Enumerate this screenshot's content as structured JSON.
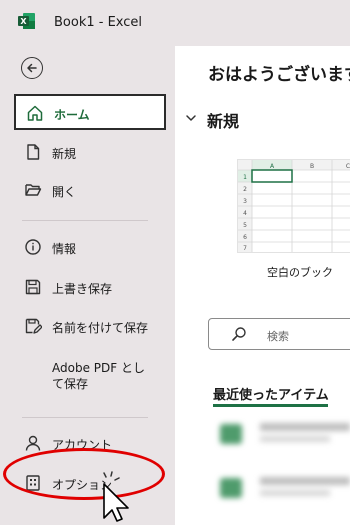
{
  "titlebar": {
    "title": "Book1  -  Excel",
    "logo_icon": "excel-icon",
    "bg_color": "#e9e4e6"
  },
  "sidebar": {
    "back_icon": "back-arrow-icon",
    "items": [
      {
        "label": "ホーム",
        "icon": "home-icon",
        "active": true
      },
      {
        "label": "新規",
        "icon": "new-document-icon"
      },
      {
        "label": "開く",
        "icon": "open-folder-icon"
      },
      {
        "label": "情報",
        "icon": "info-icon"
      },
      {
        "label": "上書き保存",
        "icon": "save-icon"
      },
      {
        "label": "名前を付けて保存",
        "icon": "save-as-icon"
      },
      {
        "label": "Adobe PDF として保存",
        "icon": ""
      },
      {
        "label": "アカウント",
        "icon": "account-icon"
      },
      {
        "label": "オプション",
        "icon": "options-icon"
      }
    ],
    "active_color": "#1e6b3a"
  },
  "main": {
    "greeting": "おはようございます",
    "new_section": {
      "label": "新規"
    },
    "blank_workbook": {
      "label": "空白のブック",
      "col_headers": [
        "A",
        "B",
        "C"
      ],
      "row_headers": [
        "1",
        "2",
        "3",
        "4",
        "5",
        "6",
        "7"
      ]
    },
    "search": {
      "placeholder": "検索"
    },
    "recent": {
      "label": "最近使ったアイテム",
      "underline_color": "#1e7145"
    }
  },
  "annotation": {
    "ellipse_color": "#e00000"
  }
}
